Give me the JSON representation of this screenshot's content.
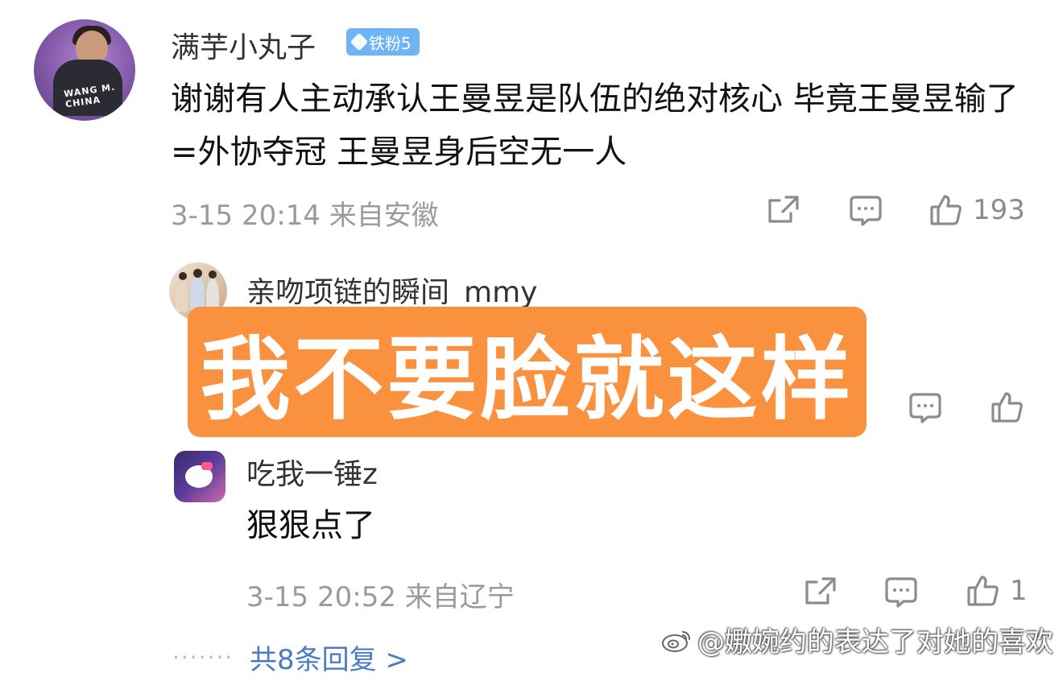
{
  "main_comment": {
    "username": "满芋小丸子",
    "badge": "铁粉5",
    "avatar_text": "WANG M.\nCHINA",
    "content": "谢谢有人主动承认王曼昱是队伍的绝对核心 毕竟王曼昱输了=外协夺冠 王曼昱身后空无一人",
    "time_location": "3-15 20:14 来自安徽",
    "like_count": "193"
  },
  "replies": [
    {
      "username": "亲吻项链的瞬间_mmy",
      "sticker_text": "我不要脸就这样"
    },
    {
      "username": "吃我一锤z",
      "content": "狠狠点了",
      "time_location": "3-15 20:52 来自辽宁",
      "like_count": "1"
    }
  ],
  "more_replies": "共8条回复 >",
  "dots": "·······",
  "watermark": "@嫐婉约的表达了对她的喜欢",
  "colors": {
    "sticker_bg": "#f9913f",
    "badge_bg": "#6fb4f5",
    "link": "#4a7cc0",
    "meta": "#9a9a9a"
  },
  "icons": [
    "share-icon",
    "comment-icon",
    "like-icon",
    "weibo-logo-icon"
  ]
}
